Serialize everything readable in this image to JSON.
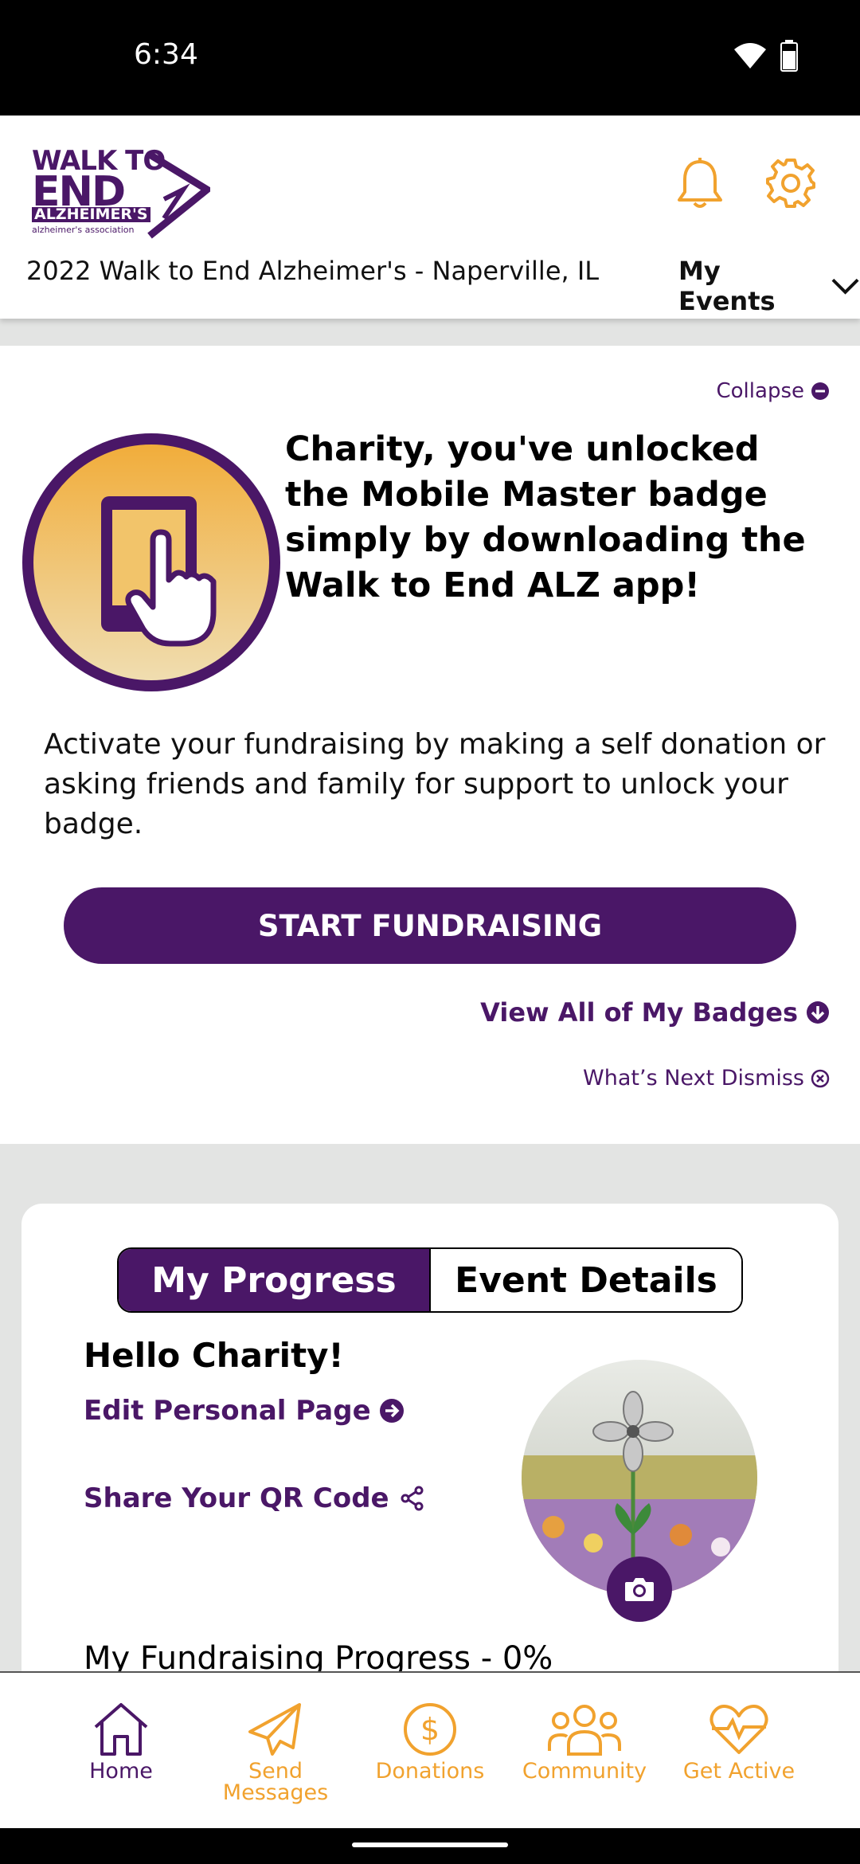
{
  "status_bar": {
    "time": "6:34"
  },
  "header": {
    "logo": {
      "walk": "WALK TO",
      "end": "END",
      "alz": "ALZHEIMER'S",
      "assoc": "alzheimer's association"
    },
    "event_name": "2022 Walk to End Alzheimer's - Naperville, IL",
    "my_events_label": "My Events"
  },
  "badge_card": {
    "collapse_label": "Collapse",
    "title": "Charity, you've unlocked the Mobile Master badge simply by downloading the Walk to End ALZ app!",
    "description": "Activate your fundraising by making a self donation or asking friends and family for support to unlock your badge.",
    "start_button": "START FUNDRAISING",
    "view_badges": "View All of My Badges",
    "whats_next": "What’s Next Dismiss"
  },
  "progress_card": {
    "tabs": [
      "My Progress",
      "Event Details"
    ],
    "active_tab": "My Progress",
    "greeting": "Hello Charity!",
    "edit_page": "Edit Personal Page",
    "share_qr": "Share Your QR Code",
    "fundraising_progress": "My Fundraising Progress - 0%"
  },
  "bottom_nav": {
    "items": [
      {
        "label": "Home",
        "icon": "home-icon",
        "active": true
      },
      {
        "label": "Send\nMessages",
        "icon": "paper-plane-icon",
        "active": false
      },
      {
        "label": "Donations",
        "icon": "dollar-icon",
        "active": false
      },
      {
        "label": "Community",
        "icon": "people-icon",
        "active": false
      },
      {
        "label": "Get Active",
        "icon": "heart-pulse-icon",
        "active": false
      }
    ]
  },
  "colors": {
    "purple": "#4a1767",
    "orange": "#f1a22e",
    "gray_bg": "#e3e4e3"
  }
}
